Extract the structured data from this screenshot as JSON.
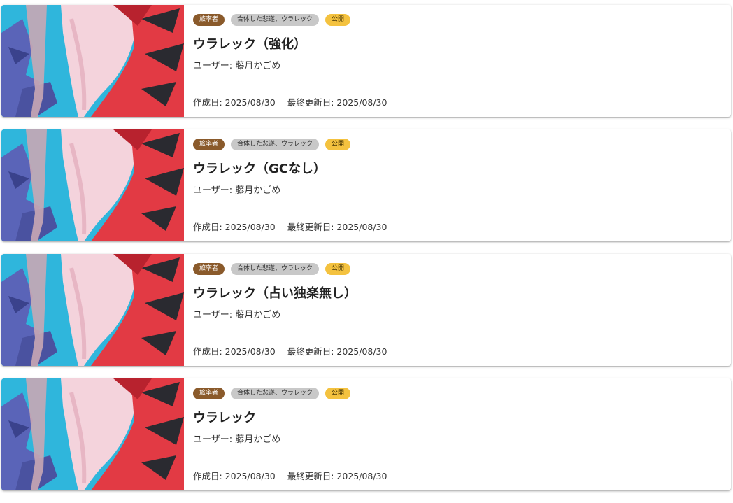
{
  "cards": [
    {
      "tags": [
        "旅率者",
        "合体した悲遂、ウラレック",
        "公開"
      ],
      "title": "ウラレック（強化）",
      "user": "ユーザー: 藤月かごめ",
      "created": "作成日: 2025/08/30",
      "updated": "最終更新日: 2025/08/30",
      "thumbnail_icon": "urarekku-artwork"
    },
    {
      "tags": [
        "旅率者",
        "合体した悲遂、ウラレック",
        "公開"
      ],
      "title": "ウラレック（GCなし）",
      "user": "ユーザー: 藤月かごめ",
      "created": "作成日: 2025/08/30",
      "updated": "最終更新日: 2025/08/30",
      "thumbnail_icon": "urarekku-artwork"
    },
    {
      "tags": [
        "旅率者",
        "合体した悲遂、ウラレック",
        "公開"
      ],
      "title": "ウラレック（占い独楽無し）",
      "user": "ユーザー: 藤月かごめ",
      "created": "作成日: 2025/08/30",
      "updated": "最終更新日: 2025/08/30",
      "thumbnail_icon": "urarekku-artwork"
    },
    {
      "tags": [
        "旅率者",
        "合体した悲遂、ウラレック",
        "公開"
      ],
      "title": "ウラレック",
      "user": "ユーザー: 藤月かごめ",
      "created": "作成日: 2025/08/30",
      "updated": "最終更新日: 2025/08/30",
      "thumbnail_icon": "urarekku-artwork"
    }
  ],
  "colors": {
    "tag_class_bg": "#8a5a2b",
    "tag_deck_bg": "#c8c8c8",
    "tag_status_bg": "#f4c23f",
    "thumb_sky": "#2fb6dc",
    "thumb_red": "#e23a44",
    "thumb_pink": "#f4d3dc",
    "thumb_purple": "#5a64b8"
  }
}
